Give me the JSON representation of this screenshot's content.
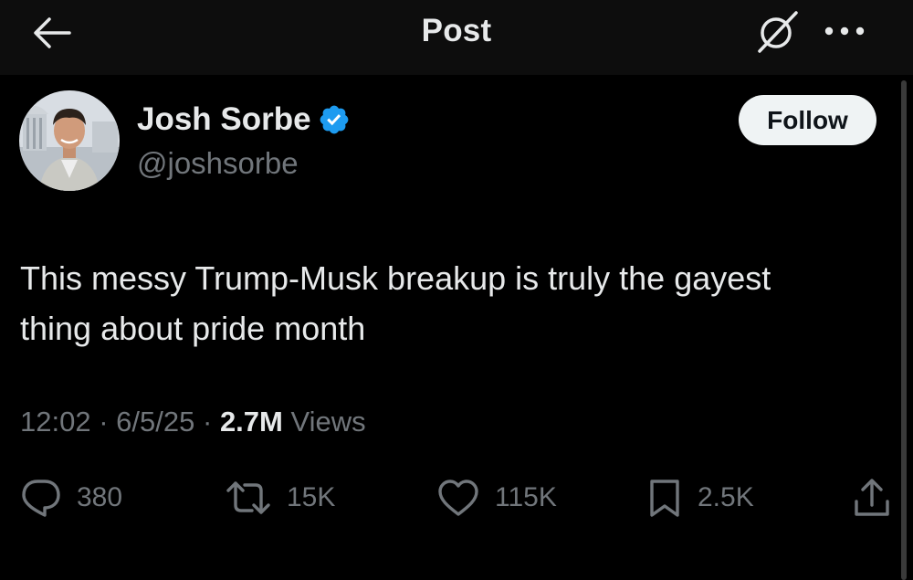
{
  "header": {
    "title": "Post",
    "icons": [
      "back-arrow-icon",
      "grok-icon",
      "more-icon"
    ]
  },
  "post": {
    "author": {
      "name": "Josh Sorbe",
      "handle": "@joshsorbe",
      "verified": true
    },
    "follow_label": "Follow",
    "text": "This messy Trump-Musk breakup is truly the gayest thing about pride month",
    "meta": {
      "time": "12:02",
      "separator": "·",
      "date": "6/5/25",
      "views_count": "2.7M",
      "views_label": "Views"
    },
    "actions": {
      "replies": "380",
      "reposts": "15K",
      "likes": "115K",
      "bookmarks": "2.5K"
    }
  },
  "colors": {
    "background": "#000000",
    "header_bg": "#0d0d0d",
    "primary_text": "#e7e9ea",
    "secondary_text": "#71767b",
    "verified_blue": "#1d9bf0",
    "follow_bg": "#eff3f4"
  }
}
